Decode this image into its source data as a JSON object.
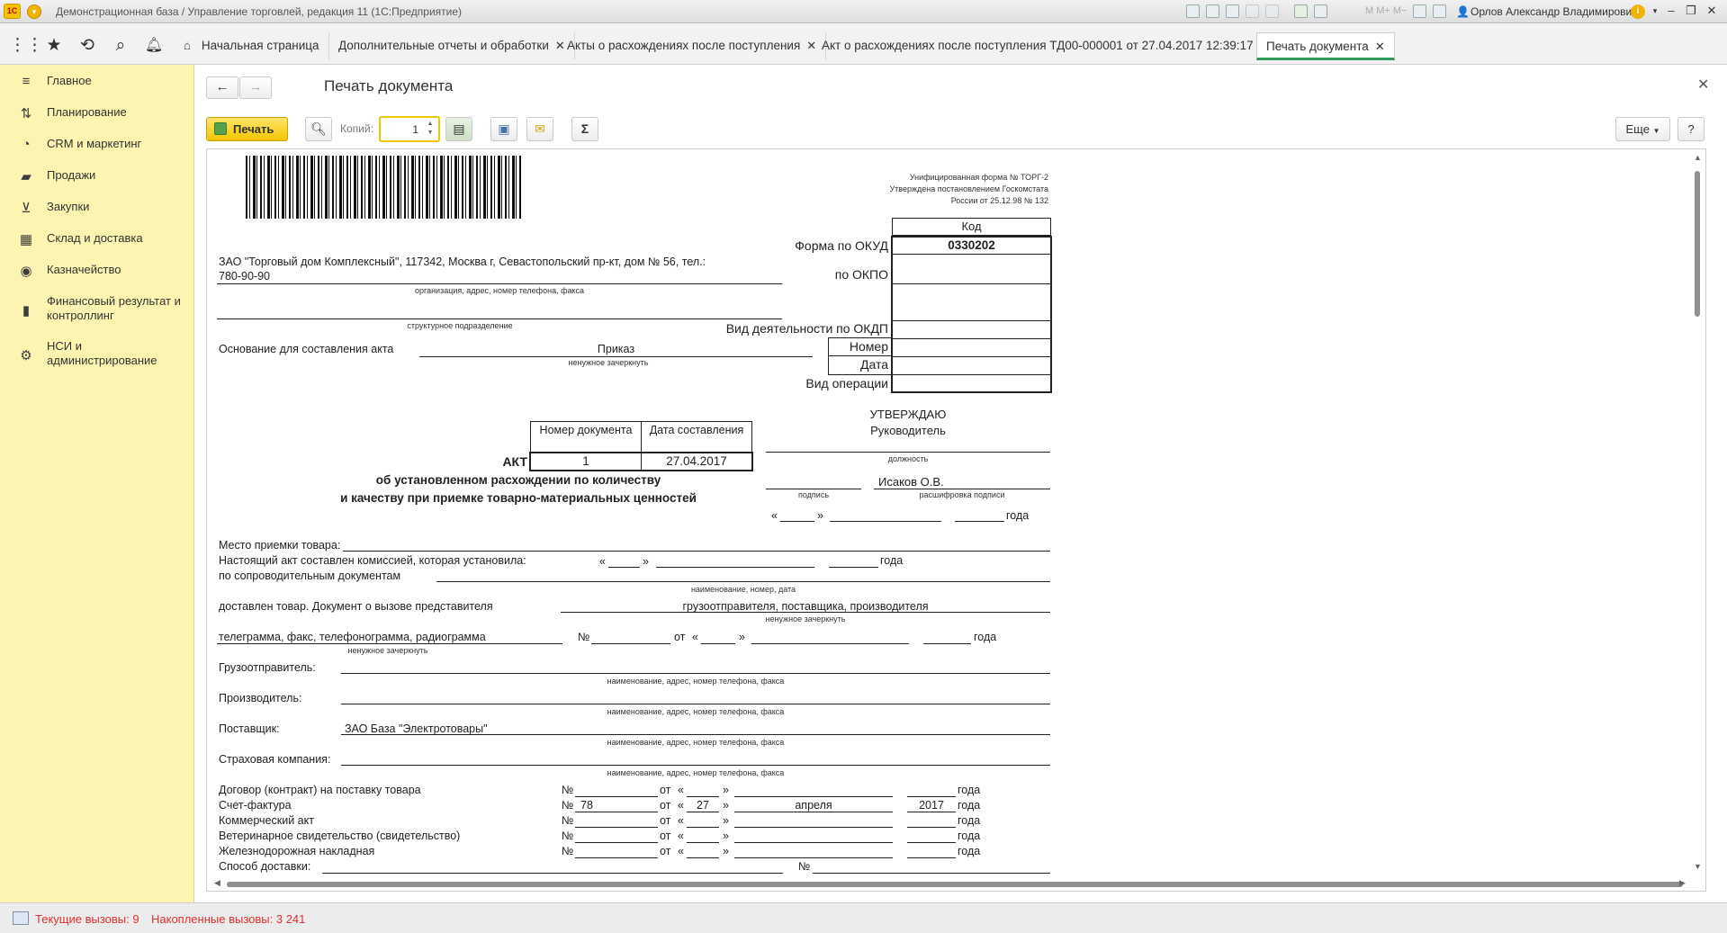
{
  "titlebar": {
    "title": "Демонстрационная база / Управление торговлей, редакция 11  (1С:Предприятие)",
    "user": "Орлов Александр Владимирович",
    "logo": "1С"
  },
  "tabs": [
    {
      "label": "Начальная страница"
    },
    {
      "label": "Дополнительные отчеты и обработки"
    },
    {
      "label": "Акты о расхождениях после поступления"
    },
    {
      "label": "Акт о расхождениях после поступления ТД00-000001 от 27.04.2017 12:39:17"
    },
    {
      "label": "Печать документа"
    }
  ],
  "sidebar": {
    "items": [
      {
        "label": "Главное",
        "icon": "menu-icon"
      },
      {
        "label": "Планирование",
        "icon": "planning-icon"
      },
      {
        "label": "CRM и маркетинг",
        "icon": "crm-icon"
      },
      {
        "label": "Продажи",
        "icon": "sales-icon"
      },
      {
        "label": "Закупки",
        "icon": "cart-icon"
      },
      {
        "label": "Склад и доставка",
        "icon": "warehouse-icon"
      },
      {
        "label": "Казначейство",
        "icon": "treasury-icon"
      },
      {
        "label": "Финансовый результат и контроллинг",
        "icon": "chart-icon"
      },
      {
        "label": "НСИ и администрирование",
        "icon": "gear-icon"
      }
    ]
  },
  "form": {
    "title": "Печать документа",
    "print_label": "Печать",
    "copies_label": "Копий:",
    "copies_value": "1",
    "more_label": "Еще",
    "help_label": "?",
    "sum_label": "Σ"
  },
  "status": {
    "current": "Текущие вызовы: 9",
    "accumulated": "Накопленные вызовы: 3 241"
  },
  "doc": {
    "header1": "Унифицированная форма № ТОРГ-2",
    "header2": "Утверждена постановлением Госкомстата",
    "header3": "России от 25.12.98 № 132",
    "code_label": "Код",
    "okud_label": "Форма по ОКУД",
    "okud_value": "0330202",
    "okpo_label": "по ОКПО",
    "okdp_label": "Вид деятельности по ОКДП",
    "number_label": "Номер",
    "date_label": "Дата",
    "optype_label": "Вид операции",
    "org_line1": "ЗАО \"Торговый дом Комплексный\", 117342, Москва г, Севастопольский пр-кт, дом № 56, тел.:",
    "org_line2": "780-90-90",
    "org_caption": "организация, адрес, номер телефона, факса",
    "dept_caption": "структурное подразделение",
    "basis_label": "Основание для составления акта",
    "basis_value": "Приказ",
    "basis_caption": "ненужное зачеркнуть",
    "doc_number_header": "Номер документа",
    "doc_date_header": "Дата составления",
    "act_label": "АКТ",
    "act_number": "1",
    "act_date": "27.04.2017",
    "act_title1": "об установленном расхождении по количеству",
    "act_title2": "и качеству при приемке товарно-материальных ценностей",
    "approve": "УТВЕРЖДАЮ",
    "manager": "Руководитель",
    "position_caption": "должность",
    "sign_caption": "подпись",
    "sign_name": "Исаков О.В.",
    "decode_caption": "расшифровка подписи",
    "quote_open": "«",
    "quote_close": "»",
    "year_word": "года",
    "place_label": "Место приемки товара:",
    "commission_label": "Настоящий акт составлен комиссией, которая установила:",
    "accomp_label": "по сопроводительным документам",
    "accomp_caption": "наименование, номер, дата",
    "delivered_label": "доставлен товар. Документ о вызове представителя",
    "delivered_value": "грузоотправителя, поставщика, производителя",
    "delivered_caption": "ненужное зачеркнуть",
    "telegram_label": "телеграмма, факс, телефонограмма, радиограмма",
    "telegram_caption": "ненужное зачеркнуть",
    "num_sign": "№",
    "from_word": "от",
    "shipper_label": "Грузоотправитель:",
    "producer_label": "Производитель:",
    "supplier_label": "Поставщик:",
    "supplier_value": "ЗАО База \"Электротовары\"",
    "insurance_label": "Страховая компания:",
    "party_caption": "наименование, адрес, номер телефона, факса",
    "contract_label": "Договор (контракт) на поставку товара",
    "invoice_label": "Счет-фактура",
    "invoice_number": "78",
    "invoice_day": "27",
    "invoice_month": "апреля",
    "invoice_year": "2017",
    "commercial_label": "Коммерческий акт",
    "vet_label": "Ветеринарное свидетельство (свидетельство)",
    "railway_label": "Железнодорожная накладная",
    "delivery_label": "Способ доставки:"
  }
}
